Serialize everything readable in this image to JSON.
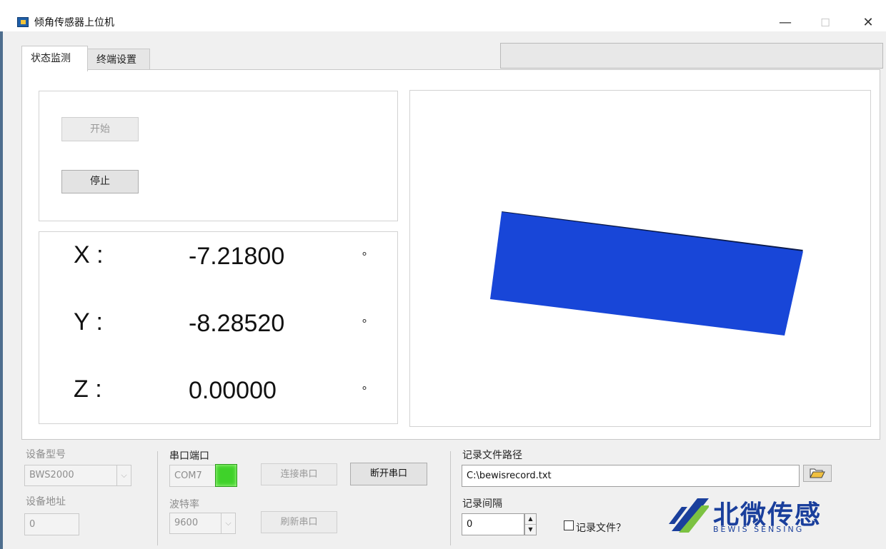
{
  "window": {
    "title": "倾角传感器上位机",
    "minimize_glyph": "—",
    "maximize_glyph": "☐",
    "close_glyph": "✕"
  },
  "tabs": [
    {
      "label": "状态监测",
      "active": true
    },
    {
      "label": "终端设置",
      "active": false
    }
  ],
  "controls": {
    "start_label": "开始",
    "stop_label": "停止"
  },
  "readings": {
    "degree_symbol": "°",
    "x": {
      "label": "X :",
      "value": "-7.21800"
    },
    "y": {
      "label": "Y :",
      "value": "-8.28520"
    },
    "z": {
      "label": "Z :",
      "value": "0.00000"
    }
  },
  "viewport_3d": {
    "object_color": "#1846d8",
    "object_edge_color": "#0a1a4a"
  },
  "device": {
    "model_label": "设备型号",
    "model_value": "BWS2000",
    "address_label": "设备地址",
    "address_value": "0"
  },
  "serial": {
    "port_label": "串口端口",
    "port_value": "COM7",
    "status_color": "#3fd22a",
    "baud_label": "波特率",
    "baud_value": "9600",
    "connect_label": "连接串口",
    "disconnect_label": "断开串口",
    "refresh_label": "刷新串口"
  },
  "record": {
    "path_label": "记录文件路径",
    "path_value": "C:\\bewisrecord.txt",
    "interval_label": "记录间隔",
    "interval_value": "0",
    "record_file_label": "记录文件？"
  },
  "logo": {
    "cn_text": "北微传感",
    "en_text": "BEWIS SENSING",
    "colors": {
      "blue": "#1a3f9c",
      "green": "#7cc242"
    }
  }
}
